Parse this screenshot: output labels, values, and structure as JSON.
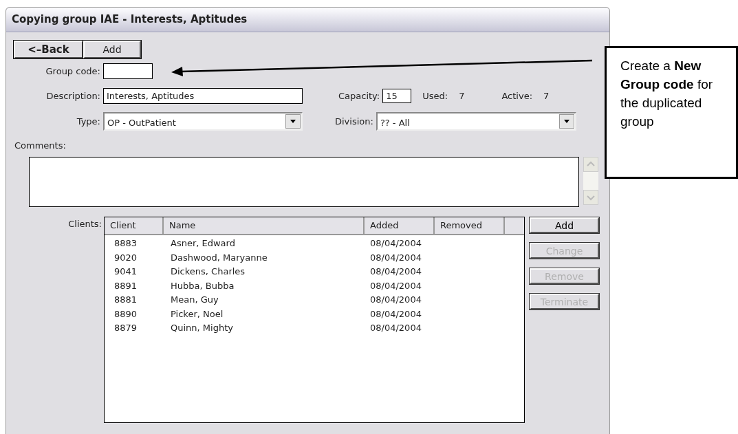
{
  "window": {
    "title": "Copying group IAE  - Interests, Aptitudes"
  },
  "toolbar": [
    {
      "label": "<–Back",
      "kind": "back"
    },
    {
      "label": "Add",
      "kind": "plain"
    }
  ],
  "group_code": {
    "label": "Group code:"
  },
  "description": {
    "label": "Description:",
    "value": "Interests, Aptitudes"
  },
  "capacity": {
    "label": "Capacity:",
    "value": "15"
  },
  "used": {
    "label": "Used:",
    "value": "7"
  },
  "active": {
    "label": "Active:",
    "value": "7"
  },
  "type": {
    "label": "Type:",
    "value": "OP - OutPatient"
  },
  "division": {
    "label": "Division:",
    "value": "?? - All"
  },
  "comments": {
    "label": "Comments:"
  },
  "clients": {
    "label": "Clients:",
    "columns": [
      "Client",
      "Name",
      "Added",
      "Removed"
    ],
    "rows": [
      {
        "client": "8883",
        "name": "Asner, Edward",
        "added": "08/04/2004"
      },
      {
        "client": "9020",
        "name": "Dashwood, Maryanne",
        "added": "08/04/2004"
      },
      {
        "client": "9041",
        "name": "Dickens, Charles",
        "added": "08/04/2004"
      },
      {
        "client": "8891",
        "name": "Hubba, Bubba",
        "added": "08/04/2004"
      },
      {
        "client": "8881",
        "name": "Mean, Guy",
        "added": "08/04/2004"
      },
      {
        "client": "8890",
        "name": "Picker, Noel",
        "added": "08/04/2004"
      },
      {
        "client": "8879",
        "name": "Quinn, Mighty",
        "added": "08/04/2004"
      }
    ]
  },
  "client_buttons": [
    {
      "label": "Add",
      "disabled": false
    },
    {
      "label": "Change",
      "disabled": true
    },
    {
      "label": "Remove",
      "disabled": true
    },
    {
      "label": "Terminate",
      "disabled": true
    }
  ],
  "callout": {
    "text": "Create a **New Group code** for the duplicated group"
  }
}
